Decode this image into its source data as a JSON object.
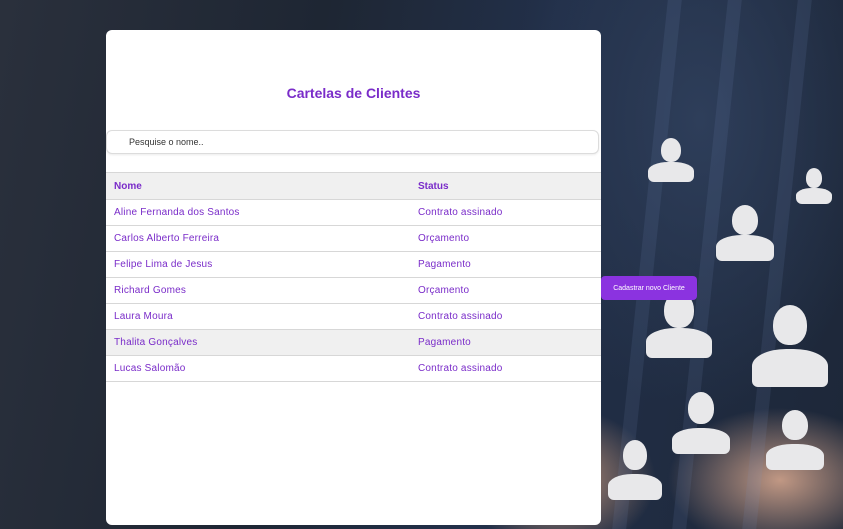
{
  "page": {
    "title": "Cartelas de Clientes"
  },
  "search": {
    "placeholder": "Pesquise o nome..",
    "value": ""
  },
  "table": {
    "headers": [
      "Nome",
      "Status"
    ],
    "rows": [
      {
        "nome": "Aline Fernanda dos Santos",
        "status": "Contrato assinado"
      },
      {
        "nome": "Carlos Alberto Ferreira",
        "status": "Orçamento"
      },
      {
        "nome": "Felipe Lima de Jesus",
        "status": "Pagamento"
      },
      {
        "nome": "Richard Gomes",
        "status": "Orçamento"
      },
      {
        "nome": "Laura Moura",
        "status": "Contrato assinado"
      },
      {
        "nome": "Thalita Gonçalves",
        "status": "Pagamento"
      },
      {
        "nome": "Lucas Salomão",
        "status": "Contrato assinado"
      }
    ],
    "highlighted_row": 5
  },
  "actions": {
    "add_client_label": "Cadastrar novo Cliente"
  },
  "colors": {
    "accent": "#7a2cc9",
    "button": "#8b33e0",
    "card": "#ffffff",
    "row_highlight": "#f0f0f0"
  }
}
